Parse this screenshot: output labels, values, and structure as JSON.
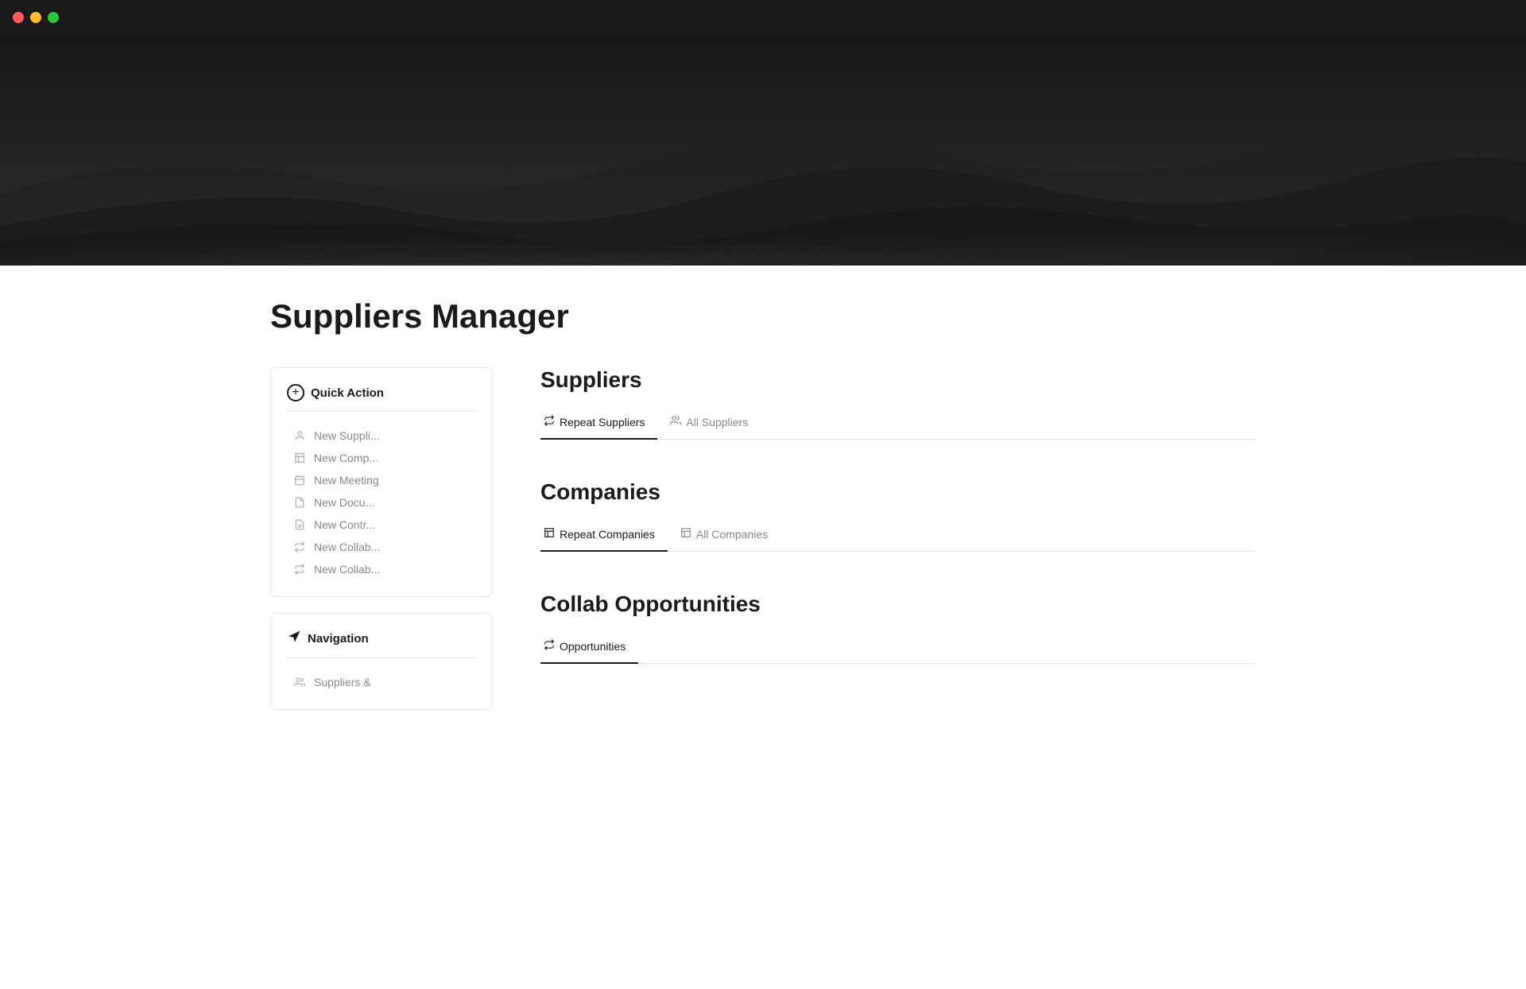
{
  "titleBar": {
    "trafficLights": [
      {
        "color": "#ff5f57",
        "name": "close"
      },
      {
        "color": "#febc2e",
        "name": "minimize"
      },
      {
        "color": "#28c840",
        "name": "maximize"
      }
    ]
  },
  "page": {
    "title": "Suppliers Manager"
  },
  "quickAction": {
    "header": "Quick Action",
    "items": [
      {
        "label": "New Suppli...",
        "icon": "person"
      },
      {
        "label": "New Comp...",
        "icon": "building"
      },
      {
        "label": "New Meeting",
        "icon": "calendar"
      },
      {
        "label": "New Docu...",
        "icon": "document"
      },
      {
        "label": "New Contr...",
        "icon": "document-list"
      },
      {
        "label": "New Collab...",
        "icon": "share"
      },
      {
        "label": "New Collab...",
        "icon": "share"
      }
    ]
  },
  "navigation": {
    "header": "Navigation",
    "items": [
      {
        "label": "Suppliers &",
        "icon": "people"
      }
    ]
  },
  "sections": [
    {
      "id": "suppliers",
      "title": "Suppliers",
      "tabs": [
        {
          "label": "Repeat Suppliers",
          "icon": "repeat",
          "active": true
        },
        {
          "label": "All Suppliers",
          "icon": "people",
          "active": false
        }
      ]
    },
    {
      "id": "companies",
      "title": "Companies",
      "tabs": [
        {
          "label": "Repeat Companies",
          "icon": "building",
          "active": true
        },
        {
          "label": "All Companies",
          "icon": "building",
          "active": false
        }
      ]
    },
    {
      "id": "collab",
      "title": "Collab Opportunities",
      "tabs": [
        {
          "label": "Opportunities",
          "icon": "repeat",
          "active": true
        }
      ]
    }
  ]
}
